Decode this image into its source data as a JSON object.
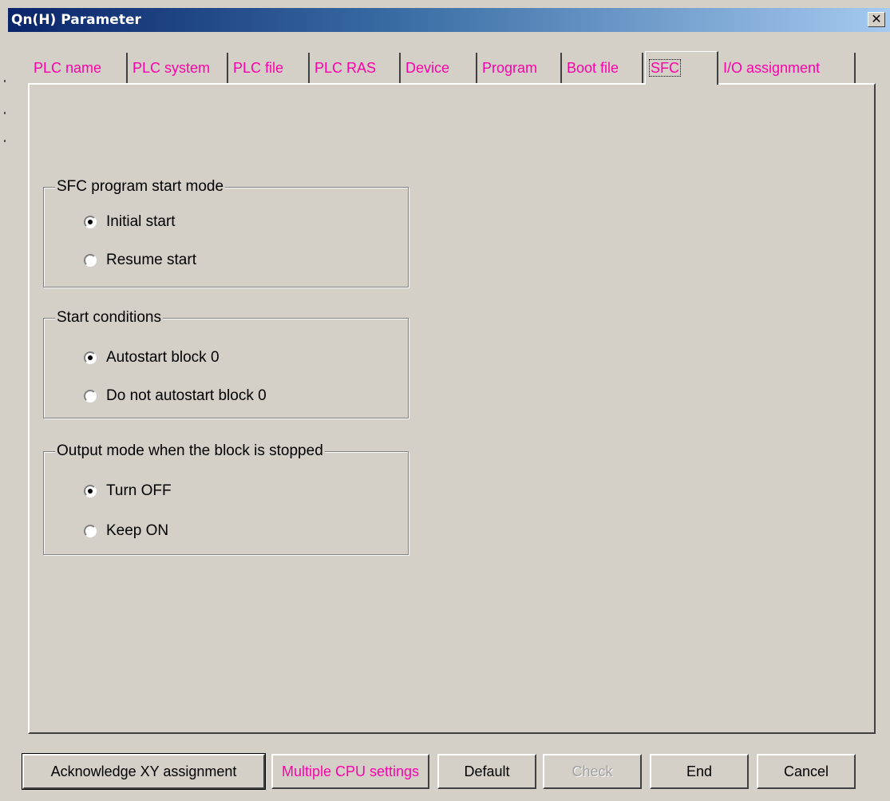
{
  "window": {
    "title": "Qn(H) Parameter",
    "close_glyph": "✕"
  },
  "tabs": [
    {
      "label": "PLC name"
    },
    {
      "label": "PLC system"
    },
    {
      "label": "PLC file"
    },
    {
      "label": "PLC RAS"
    },
    {
      "label": "Device"
    },
    {
      "label": "Program"
    },
    {
      "label": "Boot file"
    },
    {
      "label": "SFC",
      "active": true
    },
    {
      "label": "I/O assignment"
    }
  ],
  "groups": {
    "start_mode": {
      "label": "SFC program start mode",
      "options": [
        {
          "label": "Initial start",
          "checked": true
        },
        {
          "label": "Resume start",
          "checked": false
        }
      ]
    },
    "start_conditions": {
      "label": "Start conditions",
      "options": [
        {
          "label": "Autostart block 0",
          "checked": true
        },
        {
          "label": "Do not autostart block 0",
          "checked": false
        }
      ]
    },
    "output_mode": {
      "label": "Output mode when the block is stopped",
      "options": [
        {
          "label": "Turn OFF",
          "checked": true
        },
        {
          "label": "Keep ON",
          "checked": false
        }
      ]
    }
  },
  "buttons": {
    "acknowledge": "Acknowledge XY assignment",
    "multiple_cpu": "Multiple CPU settings",
    "default": "Default",
    "check": "Check",
    "end": "End",
    "cancel": "Cancel"
  },
  "colors": {
    "titlebar_start": "#0a246a",
    "titlebar_end": "#a6caf0",
    "tab_text": "#ff00aa",
    "face": "#d4d0c8"
  }
}
